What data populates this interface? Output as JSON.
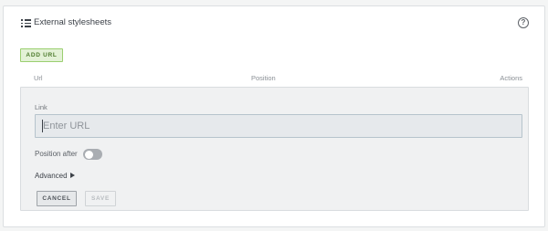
{
  "panel": {
    "title": "External stylesheets",
    "icon": "list-icon",
    "help_icon": "help-circle-icon",
    "help_glyph": "?"
  },
  "toolbar": {
    "add_url_label": "ADD URL"
  },
  "table": {
    "columns": [
      "Url",
      "Position",
      "Actions"
    ]
  },
  "form": {
    "link_label": "Link",
    "url_placeholder": "Enter URL",
    "url_value": "",
    "position_after_label": "Position after",
    "position_after_enabled": false,
    "advanced_label": "Advanced",
    "cancel_label": "CANCEL",
    "save_label": "SAVE",
    "save_enabled": false
  },
  "colors": {
    "accent_green": "#9bcf70",
    "accent_green_bg": "#e3f1d6",
    "text": "#3c4148"
  }
}
